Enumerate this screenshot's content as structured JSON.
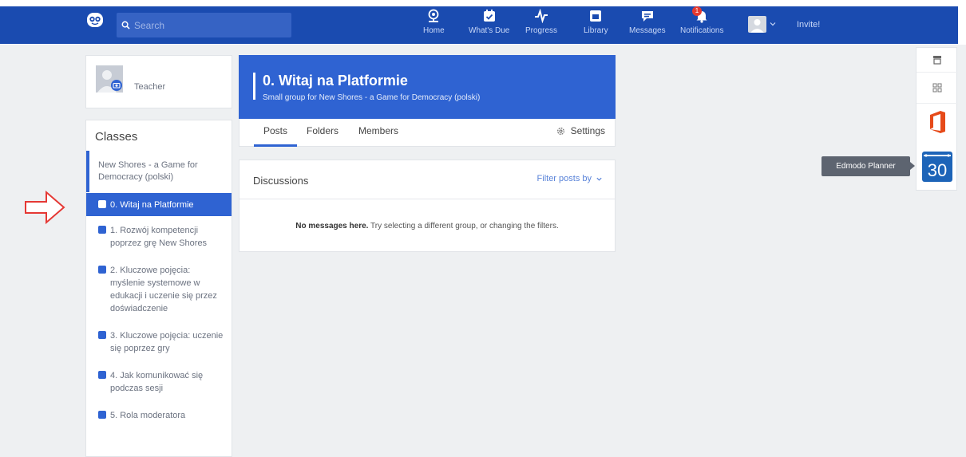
{
  "nav": {
    "search_placeholder": "Search",
    "items": [
      {
        "label": "Home",
        "icon": "home-icon"
      },
      {
        "label": "What's Due",
        "icon": "calendar-check-icon"
      },
      {
        "label": "Progress",
        "icon": "pulse-icon"
      },
      {
        "label": "Library",
        "icon": "library-icon"
      },
      {
        "label": "Messages",
        "icon": "message-icon"
      },
      {
        "label": "Notifications",
        "icon": "bell-icon",
        "badge": "1"
      }
    ],
    "invite_label": "Invite!",
    "bar_color": "#1a4bb0"
  },
  "profile": {
    "name": "Teacher"
  },
  "classes": {
    "title": "Classes",
    "parent": "New Shores - a Game for Democracy (polski)",
    "groups": [
      {
        "label": "0. Witaj na Platformie",
        "active": true
      },
      {
        "label": "1. Rozwój kompetencji poprzez grę New Shores",
        "active": false
      },
      {
        "label": "2. Kluczowe pojęcia: myślenie systemowe w edukacji i uczenie się przez doświadczenie",
        "active": false
      },
      {
        "label": "3. Kluczowe pojęcia: uczenie się poprzez gry",
        "active": false
      },
      {
        "label": "4. Jak komunikować się podczas sesji",
        "active": false
      },
      {
        "label": "5. Rola moderatora",
        "active": false
      }
    ]
  },
  "group": {
    "title": "0. Witaj na Platformie",
    "subtitle": "Small group for New Shores - a Game for Democracy (polski)",
    "tabs": [
      "Posts",
      "Folders",
      "Members"
    ],
    "active_tab": "Posts",
    "settings_label": "Settings",
    "accent_color": "#2f63d2"
  },
  "discussions": {
    "title": "Discussions",
    "filter_label": "Filter posts by",
    "empty_bold": "No messages here.",
    "empty_rest": " Try selecting a different group, or changing the filters."
  },
  "apps": {
    "tooltip": "Edmodo Planner",
    "planner_number": "30"
  }
}
